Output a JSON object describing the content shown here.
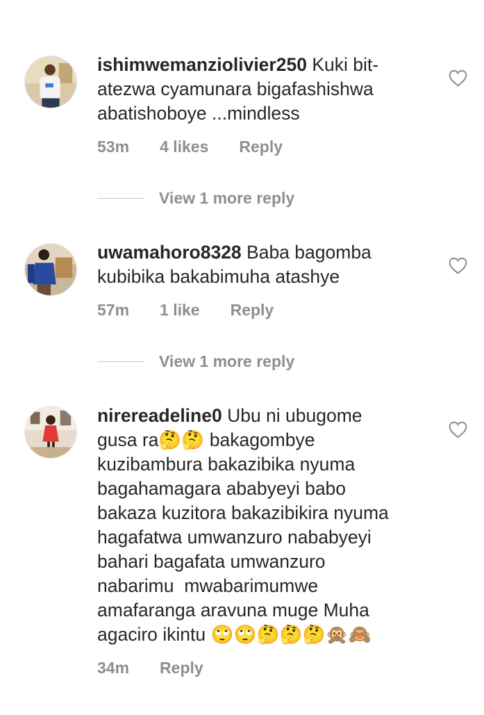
{
  "comments": [
    {
      "username": "ishimwemanziolivier250",
      "text": " Kuki bit-\natezwa cyamunara bigafashishwa\nabatishoboye ...mindless",
      "time": "53m",
      "likes": "4 likes",
      "reply": "Reply",
      "view_more": "View 1 more reply"
    },
    {
      "username": "uwamahoro8328",
      "text": " Baba bagomba\nkubibika bakabimuha atashye",
      "time": "57m",
      "likes": "1 like",
      "reply": "Reply",
      "view_more": "View 1 more reply"
    },
    {
      "username": "nirereadeline0",
      "text": " Ubu ni ubugome\ngusa ra🤔🤔 bakagombye\nkuzibambura bakazibika nyuma\nbagahamagara ababyeyi babo\nbakaza kuzitora bakazibikira nyuma\nhagafatwa umwanzuro nababyeyi\nbahari bagafata umwanzuro\nnabarimu  mwabarimumwe\namafaranga aravuna muge Muha\nagaciro ikintu 🙄🙄🤔🤔🤔🙊🙈",
      "time": "34m",
      "reply": "Reply"
    }
  ],
  "icons": {
    "like": "heart-outline-icon"
  },
  "colors": {
    "text": "#262626",
    "meta": "#8e8e8e"
  }
}
